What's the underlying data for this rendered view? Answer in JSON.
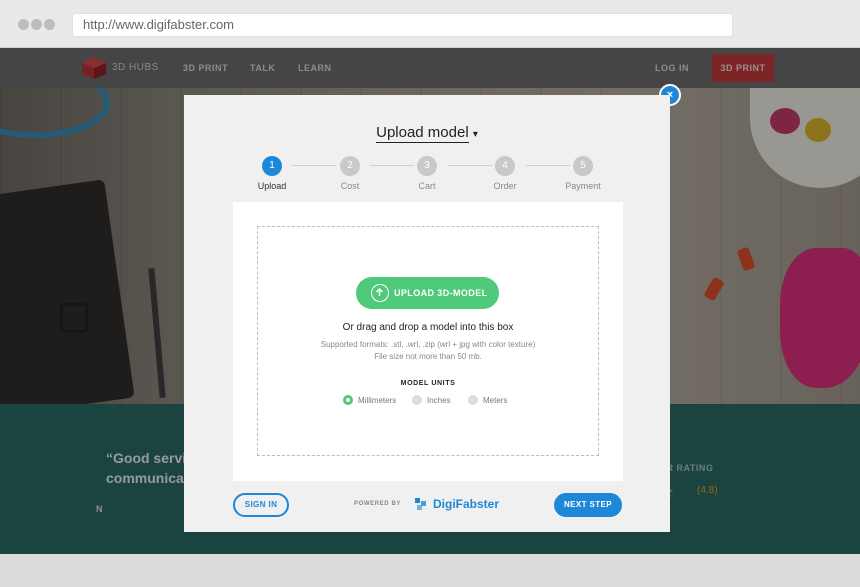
{
  "browser": {
    "url": "http://www.digifabster.com"
  },
  "site_nav": {
    "brand": "3D HUBS",
    "links": [
      "3D PRINT",
      "TALK",
      "LEARN"
    ],
    "login": "LOG IN",
    "cta": "3D PRINT"
  },
  "background": {
    "quote_line1": "“Good servic",
    "quote_line2": "communicati",
    "quote_author": "N",
    "rating_label": "ER RATING",
    "rating_score": "(4.8)"
  },
  "modal": {
    "close_label": "×",
    "title": "Upload model",
    "steps": [
      {
        "num": "1",
        "label": "Upload"
      },
      {
        "num": "2",
        "label": "Cost"
      },
      {
        "num": "3",
        "label": "Cart"
      },
      {
        "num": "4",
        "label": "Order"
      },
      {
        "num": "5",
        "label": "Payment"
      }
    ],
    "active_step": 1,
    "upload_button": "UPLOAD 3D-MODEL",
    "drag_text": "Or drag and drop a model into this box",
    "formats_line1": "Supported formats: .stl, .wrl, .zip (wrl + jpg with color texture)",
    "formats_line2": "File size not more than 50 mb.",
    "units_title": "MODEL UNITS",
    "units": [
      "Millimeters",
      "Inches",
      "Meters"
    ],
    "selected_unit": "Millimeters",
    "sign_in": "SIGN IN",
    "powered_by": "POWERED BY",
    "provider": "DigiFabster",
    "next_step": "NEXT STEP"
  },
  "colors": {
    "accent_blue": "#1e88d8",
    "upload_green": "#4fc97a",
    "nav_red": "#c0393b",
    "band_teal": "#2a6762"
  }
}
